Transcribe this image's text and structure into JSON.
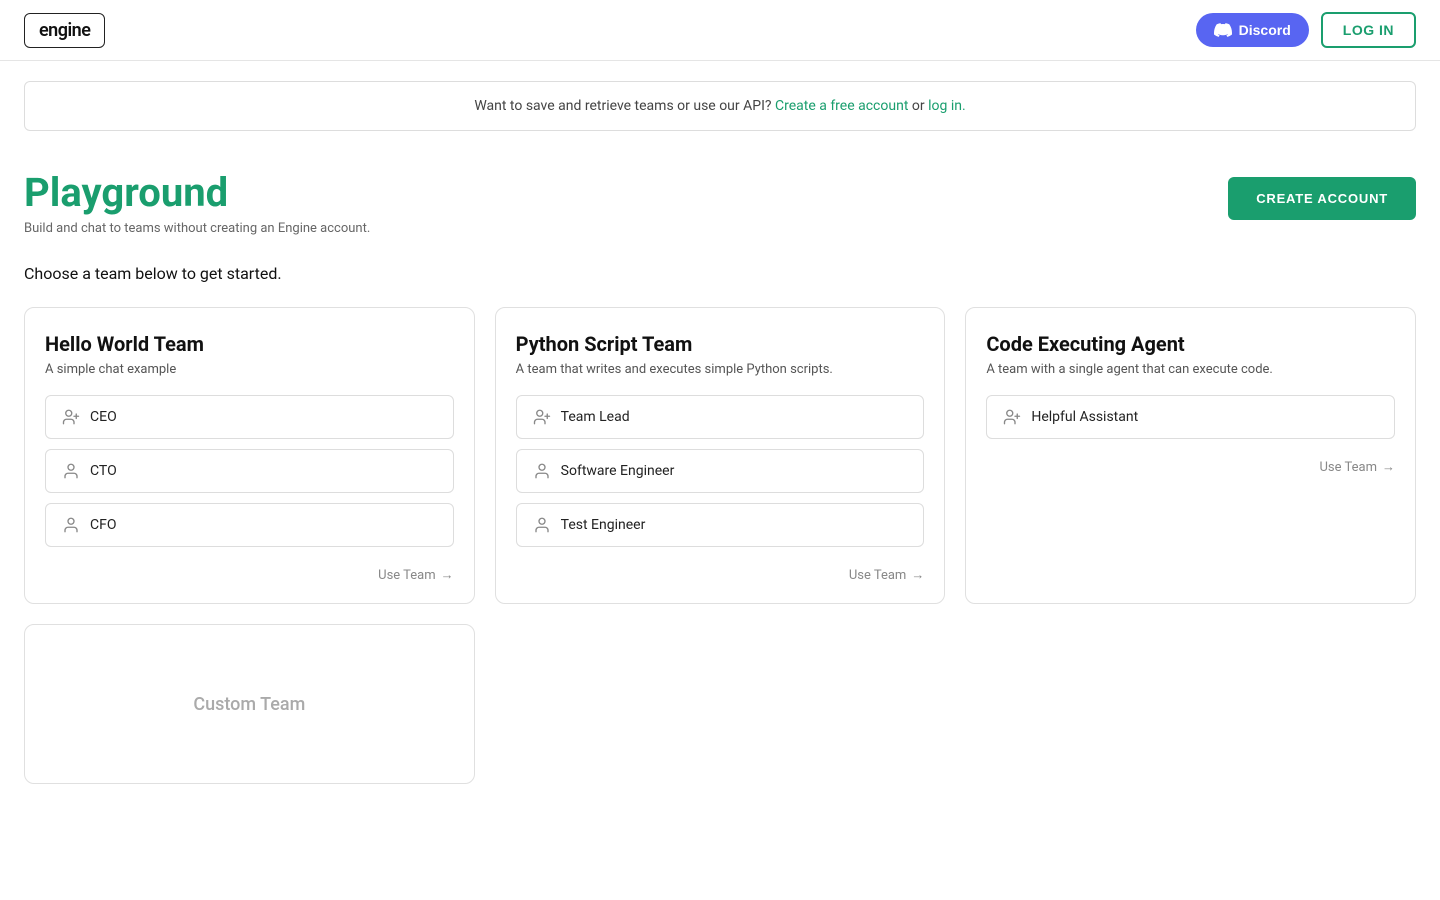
{
  "header": {
    "logo": "engine",
    "discord_label": "Discord",
    "login_label": "LOG IN"
  },
  "banner": {
    "text": "Want to save and retrieve teams or use our API?",
    "create_link": "Create a free account",
    "or_text": "or",
    "login_link": "log in."
  },
  "page": {
    "title": "Playground",
    "subtitle": "Build and chat to teams without creating an Engine account.",
    "create_account_btn": "CREATE ACCOUNT",
    "choose_text": "Choose a team below to get started."
  },
  "teams": [
    {
      "id": "hello-world",
      "title": "Hello World Team",
      "desc": "A simple chat example",
      "agents": [
        {
          "name": "CEO",
          "icon": "person-add"
        },
        {
          "name": "CTO",
          "icon": "person"
        },
        {
          "name": "CFO",
          "icon": "person"
        }
      ],
      "use_team": "Use Team"
    },
    {
      "id": "python-script",
      "title": "Python Script Team",
      "desc": "A team that writes and executes simple Python scripts.",
      "agents": [
        {
          "name": "Team Lead",
          "icon": "person-add"
        },
        {
          "name": "Software Engineer",
          "icon": "person"
        },
        {
          "name": "Test Engineer",
          "icon": "person"
        }
      ],
      "use_team": "Use Team"
    },
    {
      "id": "code-executing",
      "title": "Code Executing Agent",
      "desc": "A team with a single agent that can execute code.",
      "agents": [
        {
          "name": "Helpful Assistant",
          "icon": "person-add"
        }
      ],
      "use_team": "Use Team"
    }
  ],
  "custom_team": {
    "label": "Custom Team"
  }
}
